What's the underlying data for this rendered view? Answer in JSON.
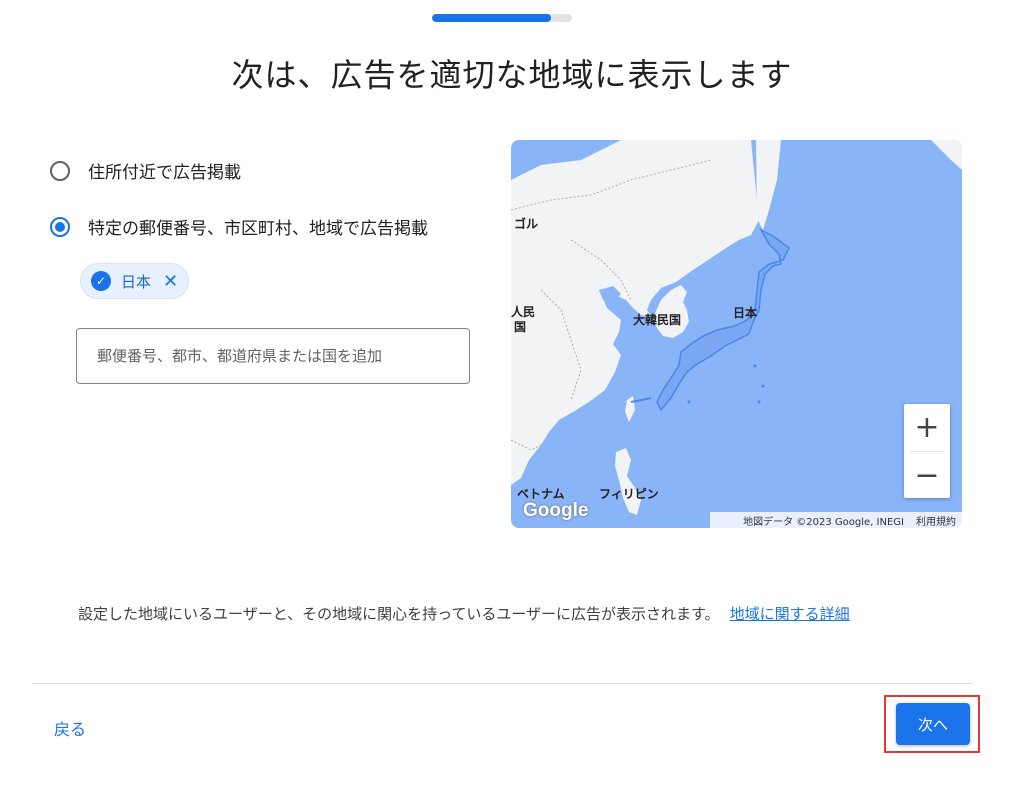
{
  "progress": {
    "fraction": 0.85
  },
  "title": "次は、広告を適切な地域に表示します",
  "options": [
    {
      "label": "住所付近で広告掲載",
      "selected": false
    },
    {
      "label": "特定の郵便番号、市区町村、地域で広告掲載",
      "selected": true
    }
  ],
  "chip": {
    "label": "日本",
    "check_icon": "✓",
    "close_icon": "✕"
  },
  "search": {
    "placeholder": "郵便番号、都市、都道府県または国を追加",
    "value": ""
  },
  "map": {
    "labels": {
      "korea": "大韓民国",
      "japan": "日本",
      "china_partial_1": "人民",
      "china_partial_2": "国",
      "mongolia_partial": "ゴル",
      "vietnam": "ベトナム",
      "philippines": "フィリピン"
    },
    "logo": "Google",
    "attribution": "地図データ ©2023 Google, INEGI",
    "terms": "利用規約",
    "zoom_in": "+",
    "zoom_out": "−",
    "colors": {
      "water": "#8ab4f8",
      "land": "#f1f3f4",
      "highlight": "#7aa6f2"
    }
  },
  "info": {
    "text": "設定した地域にいるユーザーと、その地域に関心を持っているユーザーに広告が表示されます。",
    "link": "地域に関する詳細"
  },
  "footer": {
    "back": "戻る",
    "next": "次へ"
  },
  "colors": {
    "accent": "#1a73e8",
    "highlight_box": "#e53935"
  }
}
